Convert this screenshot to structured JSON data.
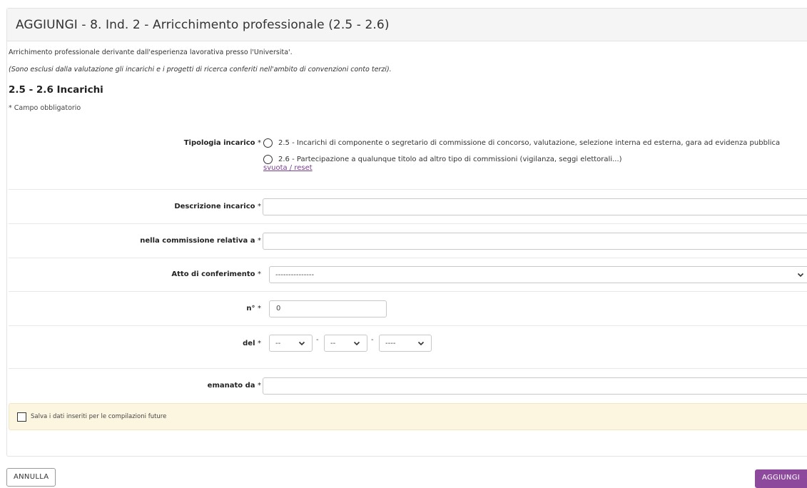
{
  "header": {
    "title": "AGGIUNGI - 8. Ind. 2 - Arricchimento professionale (2.5 - 2.6)"
  },
  "intro": {
    "text": "Arrichimento professionale derivante dall'esperienza lavorativa presso l'Universita'.",
    "note": "(Sono esclusi dalla valutazione gli incarichi e i progetti di ricerca conferiti nell'ambito di convenzioni conto terzi)."
  },
  "section": {
    "title": "2.5 - 2.6 Incarichi",
    "required_note": "* Campo obbligatorio"
  },
  "fields": {
    "tipologia": {
      "label": "Tipologia incarico",
      "required": "*",
      "options": [
        "2.5 - Incarichi di componente o segretario di commissione di concorso, valutazione, selezione interna ed esterna, gara ad evidenza pubblica",
        "2.6 - Partecipazione a qualunque titolo ad altro tipo di commissioni (vigilanza, seggi elettorali...)"
      ],
      "reset": "svuota / reset"
    },
    "descrizione": {
      "label": "Descrizione incarico",
      "required": "*",
      "value": ""
    },
    "commissione": {
      "label": "nella commissione relativa a",
      "required": "*",
      "value": ""
    },
    "atto": {
      "label": "Atto di conferimento",
      "required": "*",
      "selected": "---------------"
    },
    "numero": {
      "label": "n°",
      "required": "*",
      "value": "0"
    },
    "del": {
      "label": "del",
      "required": "*",
      "day": "--",
      "month": "--",
      "year": "----",
      "sep": "-"
    },
    "emanato": {
      "label": "emanato da",
      "required": "*",
      "value": ""
    }
  },
  "save_option": {
    "label": "Salva i dati inseriti per le compilazioni future"
  },
  "buttons": {
    "cancel": "ANNULLA",
    "add": "AGGIUNGI"
  }
}
